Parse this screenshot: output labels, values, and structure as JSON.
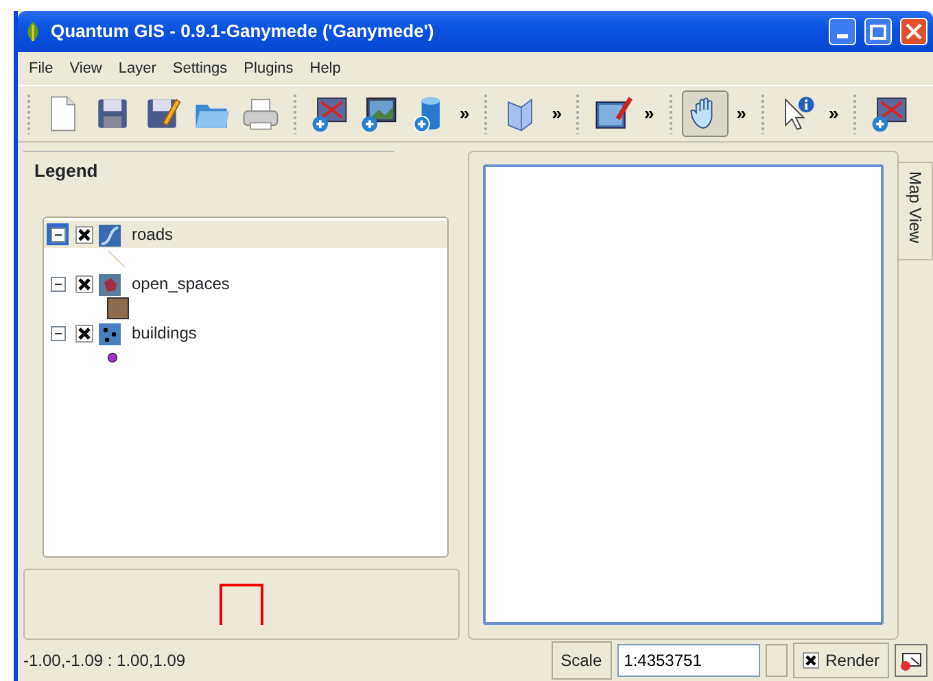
{
  "window": {
    "title": "Quantum GIS - 0.9.1-Ganymede ('Ganymede')"
  },
  "menu": [
    "File",
    "View",
    "Layer",
    "Settings",
    "Plugins",
    "Help"
  ],
  "toolbar": [
    {
      "kind": "grip"
    },
    {
      "kind": "button",
      "pressed": false
    },
    {
      "kind": "button",
      "pressed": false
    },
    {
      "kind": "button",
      "pressed": false
    },
    {
      "kind": "button",
      "pressed": false
    },
    {
      "kind": "button",
      "pressed": false
    },
    {
      "kind": "grip"
    },
    {
      "kind": "button",
      "pressed": false
    },
    {
      "kind": "button",
      "pressed": false
    },
    {
      "kind": "button",
      "pressed": false
    },
    {
      "kind": "more",
      "label": "»"
    },
    {
      "kind": "grip"
    },
    {
      "kind": "button",
      "pressed": false
    },
    {
      "kind": "more",
      "label": "»"
    },
    {
      "kind": "grip"
    },
    {
      "kind": "button",
      "pressed": false
    },
    {
      "kind": "more",
      "label": "»"
    },
    {
      "kind": "grip"
    },
    {
      "kind": "button",
      "pressed": true
    },
    {
      "kind": "more",
      "label": "»"
    },
    {
      "kind": "grip"
    },
    {
      "kind": "button",
      "pressed": false
    },
    {
      "kind": "more",
      "label": "»"
    },
    {
      "kind": "grip"
    },
    {
      "kind": "button",
      "pressed": false
    }
  ],
  "legend": {
    "title": "Legend",
    "layers": [
      {
        "name": "roads",
        "kind": "line",
        "expanded": true,
        "visible": true,
        "selected": true,
        "color": "#e8d8c0"
      },
      {
        "name": "open_spaces",
        "kind": "polygon",
        "expanded": true,
        "visible": true,
        "selected": false,
        "color": "#8c6e4e"
      },
      {
        "name": "buildings",
        "kind": "point",
        "expanded": true,
        "visible": true,
        "selected": false,
        "color": "#9933cc"
      }
    ]
  },
  "map_view_tab": {
    "label": "Map View"
  },
  "status_bar": {
    "coordinates": "-1.00,-1.09 : 1.00,1.09",
    "scale_label": "Scale",
    "scale_value": "1:4353751",
    "render": {
      "label": "Render",
      "checked": true
    }
  }
}
